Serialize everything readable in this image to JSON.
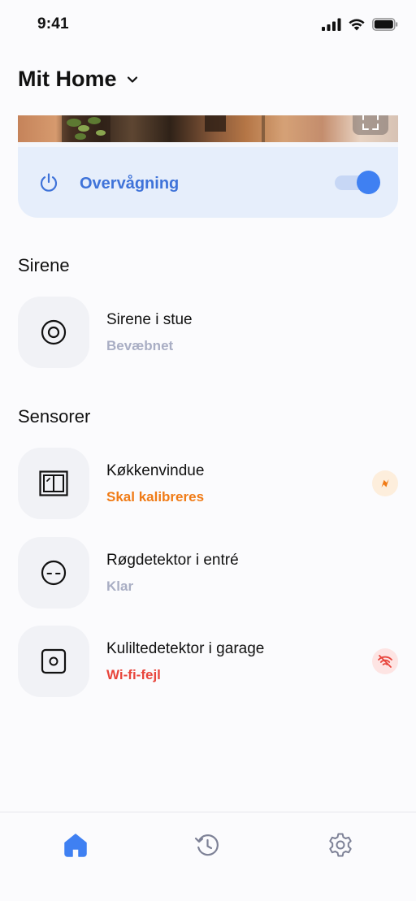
{
  "status_bar": {
    "time": "9:41"
  },
  "header": {
    "title": "Mit Home"
  },
  "monitoring": {
    "label": "Overvågning",
    "enabled": true,
    "accent": "#3f80f2"
  },
  "sections": {
    "siren": {
      "title": "Sirene",
      "devices": [
        {
          "name": "Sirene i stue",
          "status": "Bevæbnet",
          "icon": "siren-icon"
        }
      ]
    },
    "sensors": {
      "title": "Sensorer",
      "devices": [
        {
          "name": "Køkkenvindue",
          "status": "Skal kalibreres",
          "icon": "window-sensor-icon",
          "badge": "compass-icon",
          "status_color": "#f07b16"
        },
        {
          "name": "Røgdetektor i entré",
          "status": "Klar",
          "icon": "smoke-detector-icon"
        },
        {
          "name": "Kuliltedetektor i garage",
          "status": "Wi-fi-fejl",
          "icon": "co-detector-icon",
          "badge": "wifi-off-icon",
          "status_color": "#e8453c"
        }
      ]
    }
  },
  "bottom_nav": {
    "items": [
      {
        "icon": "home-icon",
        "active": true
      },
      {
        "icon": "history-icon",
        "active": false
      },
      {
        "icon": "settings-icon",
        "active": false
      }
    ]
  }
}
